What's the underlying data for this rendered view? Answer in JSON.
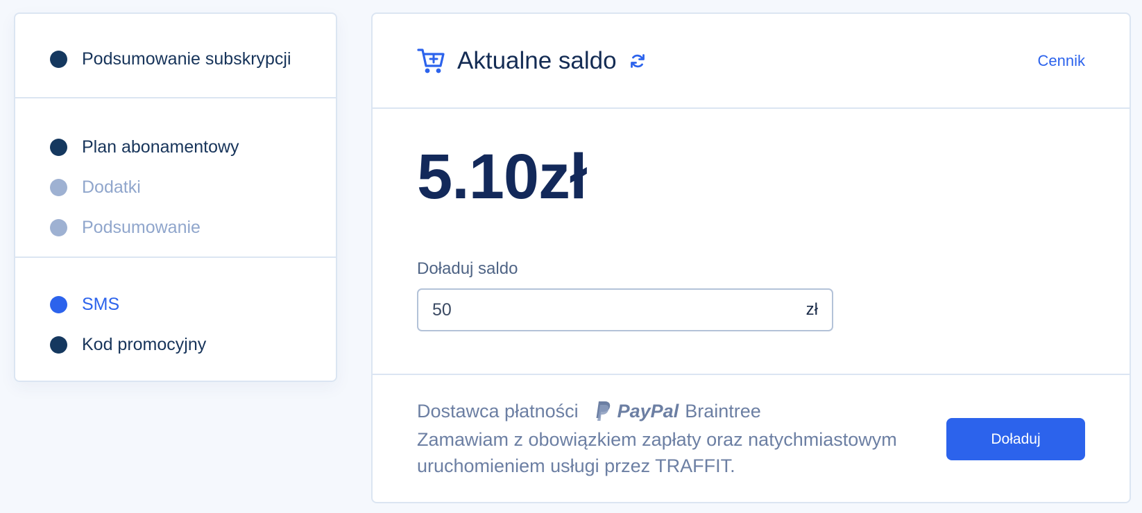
{
  "sidebar": {
    "sections": [
      {
        "items": [
          {
            "label": "Podsumowanie subskrypcji",
            "state": "done"
          }
        ]
      },
      {
        "items": [
          {
            "label": "Plan abonamentowy",
            "state": "done"
          },
          {
            "label": "Dodatki",
            "state": "pending"
          },
          {
            "label": "Podsumowanie",
            "state": "pending"
          }
        ]
      },
      {
        "items": [
          {
            "label": "SMS",
            "state": "active"
          },
          {
            "label": "Kod promocyjny",
            "state": "done"
          }
        ]
      }
    ]
  },
  "card": {
    "icon": "cart-plus-icon",
    "title": "Aktualne saldo",
    "refresh_icon": "refresh-icon",
    "pricing_link": "Cennik",
    "balance": "5.10zł",
    "topup": {
      "label": "Doładuj saldo",
      "value": "50",
      "currency": "zł"
    },
    "footer": {
      "provider_label": "Dostawca płatności",
      "provider_brand": "PayPal",
      "provider_suffix": "Braintree",
      "consent": "Zamawiam z obowiązkiem zapłaty oraz natychmiastowym uruchomieniem usługi przez TRAFFIT.",
      "button": "Doładuj"
    }
  },
  "colors": {
    "accent": "#2c63ec",
    "dark": "#15385f",
    "muted": "#9eb1d2"
  }
}
